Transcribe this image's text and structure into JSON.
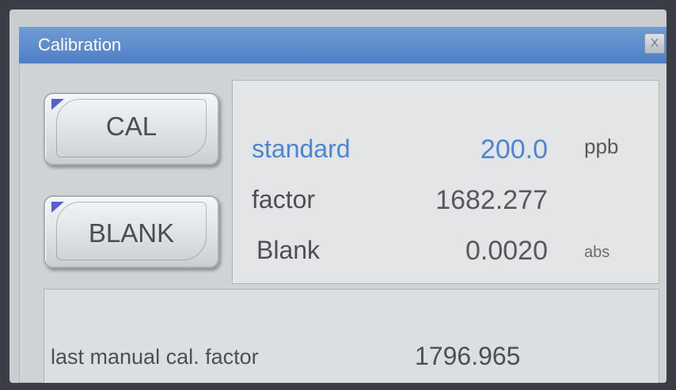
{
  "window": {
    "title": "Calibration",
    "close_label": "X"
  },
  "buttons": {
    "cal_label": "CAL",
    "blank_label": "BLANK"
  },
  "values": {
    "standard": {
      "label": "standard",
      "value": "200.0",
      "unit": "ppb"
    },
    "factor": {
      "label": "factor",
      "value": "1682.277",
      "unit": ""
    },
    "blank": {
      "label": "Blank",
      "value": "0.0020",
      "unit": "abs"
    }
  },
  "last_cal": {
    "label": "last manual cal. factor",
    "value": "1796.965"
  },
  "colors": {
    "titlebar": "#5a88cb",
    "highlight_text": "#4a86d6",
    "corner_marker": "#5a5fd0"
  }
}
